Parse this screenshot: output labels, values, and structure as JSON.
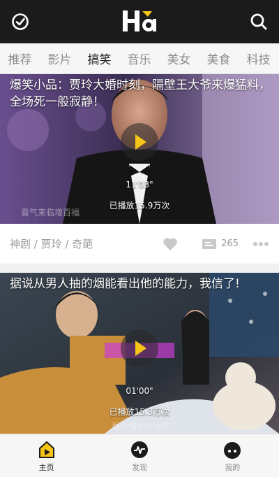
{
  "header": {
    "logo_text": "Ha"
  },
  "tabs": [
    {
      "label": "推荐"
    },
    {
      "label": "影片"
    },
    {
      "label": "搞笑",
      "active": true
    },
    {
      "label": "音乐"
    },
    {
      "label": "美女"
    },
    {
      "label": "美食"
    },
    {
      "label": "科技"
    }
  ],
  "feed": [
    {
      "title": "爆笑小品：贾玲大婚时刻，隔壁王大爷来爆猛料，全场死一般寂静！",
      "duration": "11'03\"",
      "plays": "已播放15.9万次",
      "watermark": "喜气来临增百福",
      "tags": "神剧 / 贾玲 / 奇葩",
      "comment_count": "265"
    },
    {
      "title": "据说从男人抽的烟能看出他的能力，我信了!",
      "duration": "01'00\"",
      "plays": "已播放15.3万次",
      "watermark": "最你懂到个本坏!"
    }
  ],
  "bottom_nav": [
    {
      "label": "主页",
      "icon": "home-play-icon",
      "active": true
    },
    {
      "label": "发现",
      "icon": "discover-pulse-icon"
    },
    {
      "label": "我的",
      "icon": "profile-face-icon"
    }
  ],
  "colors": {
    "accent": "#f5c518",
    "header_bg": "#1b1b1b"
  }
}
